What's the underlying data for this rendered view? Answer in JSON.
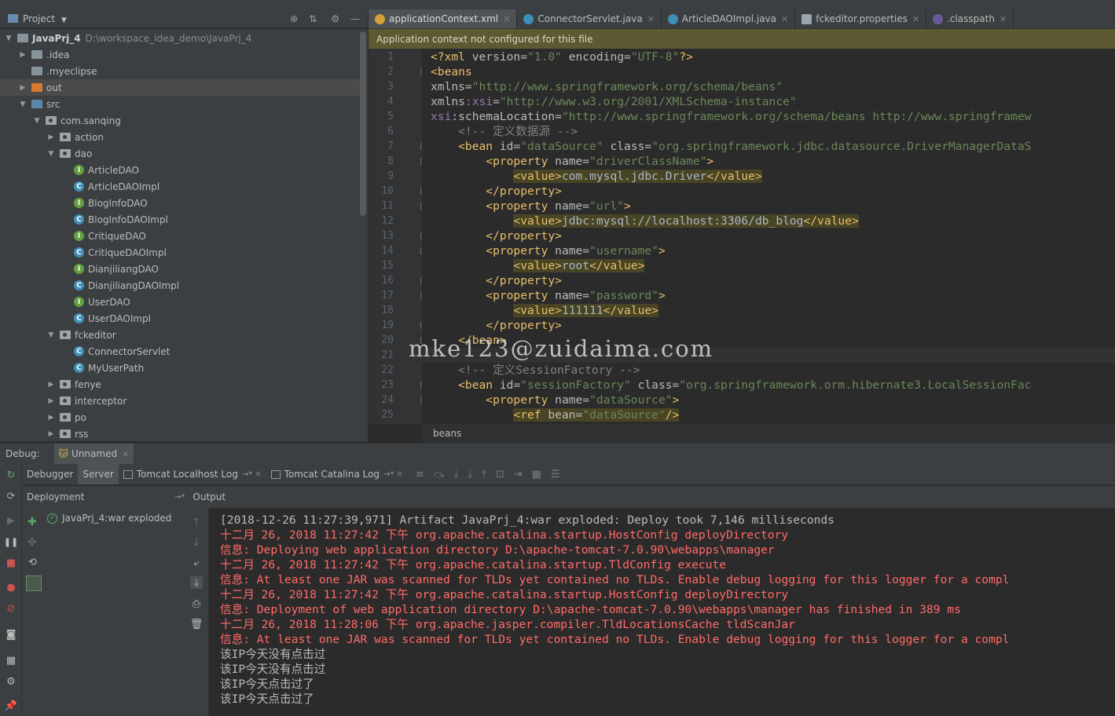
{
  "project_panel": {
    "title": "Project",
    "tree": [
      {
        "label": "JavaPrj_4",
        "path": "D:\\workspace_idea_demo\\JavaPrj_4",
        "depth": 0,
        "type": "module",
        "expanded": true
      },
      {
        "label": ".idea",
        "depth": 1,
        "type": "folder",
        "expanded": false
      },
      {
        "label": ".myeclipse",
        "depth": 1,
        "type": "folder",
        "expanded": null
      },
      {
        "label": "out",
        "depth": 1,
        "type": "folder-orange",
        "expanded": false,
        "selected": true
      },
      {
        "label": "src",
        "depth": 1,
        "type": "folder-blue",
        "expanded": true
      },
      {
        "label": "com.sanqing",
        "depth": 2,
        "type": "package",
        "expanded": true
      },
      {
        "label": "action",
        "depth": 3,
        "type": "package",
        "expanded": false
      },
      {
        "label": "dao",
        "depth": 3,
        "type": "package",
        "expanded": true
      },
      {
        "label": "ArticleDAO",
        "depth": 4,
        "type": "interface"
      },
      {
        "label": "ArticleDAOImpl",
        "depth": 4,
        "type": "class"
      },
      {
        "label": "BlogInfoDAO",
        "depth": 4,
        "type": "interface"
      },
      {
        "label": "BlogInfoDAOImpl",
        "depth": 4,
        "type": "class"
      },
      {
        "label": "CritiqueDAO",
        "depth": 4,
        "type": "interface"
      },
      {
        "label": "CritiqueDAOImpl",
        "depth": 4,
        "type": "class"
      },
      {
        "label": "DianjiliangDAO",
        "depth": 4,
        "type": "interface"
      },
      {
        "label": "DianjiliangDAOImpl",
        "depth": 4,
        "type": "class"
      },
      {
        "label": "UserDAO",
        "depth": 4,
        "type": "interface"
      },
      {
        "label": "UserDAOImpl",
        "depth": 4,
        "type": "class"
      },
      {
        "label": "fckeditor",
        "depth": 3,
        "type": "package",
        "expanded": true
      },
      {
        "label": "ConnectorServlet",
        "depth": 4,
        "type": "class"
      },
      {
        "label": "MyUserPath",
        "depth": 4,
        "type": "class"
      },
      {
        "label": "fenye",
        "depth": 3,
        "type": "package",
        "expanded": false
      },
      {
        "label": "interceptor",
        "depth": 3,
        "type": "package",
        "expanded": false
      },
      {
        "label": "po",
        "depth": 3,
        "type": "package",
        "expanded": false
      },
      {
        "label": "rss",
        "depth": 3,
        "type": "package",
        "expanded": false
      }
    ]
  },
  "editor": {
    "tabs": [
      {
        "label": "applicationContext.xml",
        "icon": "xml-icon",
        "active": true
      },
      {
        "label": "ConnectorServlet.java",
        "icon": "class-icon",
        "active": false
      },
      {
        "label": "ArticleDAOImpl.java",
        "icon": "class-icon",
        "active": false
      },
      {
        "label": "fckeditor.properties",
        "icon": "properties-icon",
        "active": false
      },
      {
        "label": ".classpath",
        "icon": "eclipse-icon",
        "active": false
      }
    ],
    "banner": "Application context not configured for this file",
    "breadcrumb": "beans",
    "current_line": 21,
    "lines": [
      {
        "n": "1",
        "segs": [
          [
            "pi",
            "<?xml "
          ],
          [
            "an",
            "version="
          ],
          [
            "av",
            "\"1.0\""
          ],
          [
            "an",
            " encoding="
          ],
          [
            "av",
            "\"UTF-8\""
          ],
          [
            "pi",
            "?>"
          ]
        ]
      },
      {
        "n": "2",
        "segs": [
          [
            "t",
            "<beans"
          ]
        ]
      },
      {
        "n": "3",
        "segs": [
          [
            "an",
            "xmlns="
          ],
          [
            "av",
            "\"http://www.springframework.org/schema/beans\""
          ]
        ]
      },
      {
        "n": "4",
        "segs": [
          [
            "an",
            "xmlns"
          ],
          [
            "ns",
            ":xsi"
          ],
          [
            "an",
            "="
          ],
          [
            "av",
            "\"http://www.w3.org/2001/XMLSchema-instance\""
          ]
        ]
      },
      {
        "n": "5",
        "segs": [
          [
            "ns",
            "xsi"
          ],
          [
            "an",
            ":schemaLocation="
          ],
          [
            "av",
            "\"http://www.springframework.org/schema/beans http://www.springframew"
          ]
        ]
      },
      {
        "n": "6",
        "segs": [
          [
            "cm",
            "    <!-- 定义数据源 -->"
          ]
        ]
      },
      {
        "n": "7",
        "segs": [
          [
            "t",
            "    <bean "
          ],
          [
            "an",
            "id="
          ],
          [
            "av",
            "\"dataSource\""
          ],
          [
            "an",
            " class="
          ],
          [
            "av",
            "\"org.springframework.jdbc.datasource.DriverManagerDataS"
          ]
        ]
      },
      {
        "n": "8",
        "segs": [
          [
            "t",
            "        <property "
          ],
          [
            "an",
            "name="
          ],
          [
            "av",
            "\"driverClassName\""
          ],
          [
            "t",
            ">"
          ]
        ]
      },
      {
        "n": "9",
        "segs": [
          [
            "sp",
            "            "
          ],
          [
            "hlt",
            "<value>"
          ],
          [
            "hlc",
            "com.mysql.jdbc.Driver"
          ],
          [
            "hlt",
            "</value>"
          ]
        ]
      },
      {
        "n": "10",
        "segs": [
          [
            "t",
            "        </property>"
          ]
        ]
      },
      {
        "n": "11",
        "segs": [
          [
            "t",
            "        <property "
          ],
          [
            "an",
            "name="
          ],
          [
            "av",
            "\"url\""
          ],
          [
            "t",
            ">"
          ]
        ]
      },
      {
        "n": "12",
        "segs": [
          [
            "sp",
            "            "
          ],
          [
            "hlt",
            "<value>"
          ],
          [
            "hlc",
            "jdbc:mysql://localhost:3306/db_blog"
          ],
          [
            "hlt",
            "</value>"
          ]
        ]
      },
      {
        "n": "13",
        "segs": [
          [
            "t",
            "        </property>"
          ]
        ]
      },
      {
        "n": "14",
        "segs": [
          [
            "t",
            "        <property "
          ],
          [
            "an",
            "name="
          ],
          [
            "av",
            "\"username\""
          ],
          [
            "t",
            ">"
          ]
        ]
      },
      {
        "n": "15",
        "segs": [
          [
            "sp",
            "            "
          ],
          [
            "hlt",
            "<value>"
          ],
          [
            "hlc",
            "root"
          ],
          [
            "hlt",
            "</value>"
          ]
        ]
      },
      {
        "n": "16",
        "segs": [
          [
            "t",
            "        </property>"
          ]
        ]
      },
      {
        "n": "17",
        "segs": [
          [
            "t",
            "        <property "
          ],
          [
            "an",
            "name="
          ],
          [
            "av",
            "\"password\""
          ],
          [
            "t",
            ">"
          ]
        ]
      },
      {
        "n": "18",
        "segs": [
          [
            "sp",
            "            "
          ],
          [
            "hlt",
            "<value>"
          ],
          [
            "hlc",
            "111111"
          ],
          [
            "hlt",
            "</value>"
          ]
        ]
      },
      {
        "n": "19",
        "segs": [
          [
            "t",
            "        </property>"
          ]
        ]
      },
      {
        "n": "20",
        "segs": [
          [
            "t",
            "    </bean>"
          ]
        ]
      },
      {
        "n": "21",
        "segs": []
      },
      {
        "n": "22",
        "segs": [
          [
            "cm",
            "    <!-- 定义SessionFactory -->"
          ]
        ]
      },
      {
        "n": "23",
        "segs": [
          [
            "t",
            "    <bean "
          ],
          [
            "an",
            "id="
          ],
          [
            "av",
            "\"sessionFactory\""
          ],
          [
            "an",
            " class="
          ],
          [
            "av",
            "\"org.springframework.orm.hibernate3.LocalSessionFac"
          ]
        ]
      },
      {
        "n": "24",
        "segs": [
          [
            "t",
            "        <property "
          ],
          [
            "an",
            "name="
          ],
          [
            "av",
            "\"dataSource\""
          ],
          [
            "t",
            ">"
          ]
        ]
      },
      {
        "n": "25",
        "segs": [
          [
            "sp",
            "            "
          ],
          [
            "hlt",
            "<ref "
          ],
          [
            "hla",
            "bean="
          ],
          [
            "hlv",
            "\"dataSource\""
          ],
          [
            "hlt",
            "/>"
          ]
        ]
      }
    ]
  },
  "watermark": "mke123@zuidaima.com",
  "debug": {
    "label": "Debug:",
    "session": "Unnamed",
    "tabs": [
      {
        "label": "Debugger",
        "active": false
      },
      {
        "label": "Server",
        "active": true
      },
      {
        "label": "Tomcat Localhost Log",
        "suffix": "→*"
      },
      {
        "label": "Tomcat Catalina Log",
        "suffix": "→*"
      }
    ],
    "deployment_header": "Deployment",
    "output_header": "Output",
    "deployment_items": [
      {
        "label": "JavaPrj_4:war exploded"
      }
    ],
    "console": [
      {
        "kind": "norm",
        "text": "[2018-12-26 11:27:39,971] Artifact JavaPrj_4:war exploded: Deploy took 7,146 milliseconds"
      },
      {
        "kind": "err",
        "text": "十二月 26, 2018 11:27:42 下午 org.apache.catalina.startup.HostConfig deployDirectory"
      },
      {
        "kind": "err",
        "text": "信息: Deploying web application directory D:\\apache-tomcat-7.0.90\\webapps\\manager"
      },
      {
        "kind": "err",
        "text": "十二月 26, 2018 11:27:42 下午 org.apache.catalina.startup.TldConfig execute"
      },
      {
        "kind": "err",
        "text": "信息: At least one JAR was scanned for TLDs yet contained no TLDs. Enable debug logging for this logger for a compl"
      },
      {
        "kind": "err",
        "text": "十二月 26, 2018 11:27:42 下午 org.apache.catalina.startup.HostConfig deployDirectory"
      },
      {
        "kind": "err",
        "text": "信息: Deployment of web application directory D:\\apache-tomcat-7.0.90\\webapps\\manager has finished in 389 ms"
      },
      {
        "kind": "err",
        "text": "十二月 26, 2018 11:28:06 下午 org.apache.jasper.compiler.TldLocationsCache tldScanJar"
      },
      {
        "kind": "err",
        "text": "信息: At least one JAR was scanned for TLDs yet contained no TLDs. Enable debug logging for this logger for a compl"
      },
      {
        "kind": "norm",
        "text": "该IP今天没有点击过"
      },
      {
        "kind": "norm",
        "text": "该IP今天没有点击过"
      },
      {
        "kind": "norm",
        "text": "该IP今天点击过了"
      },
      {
        "kind": "norm",
        "text": "该IP今天点击过了"
      }
    ]
  }
}
